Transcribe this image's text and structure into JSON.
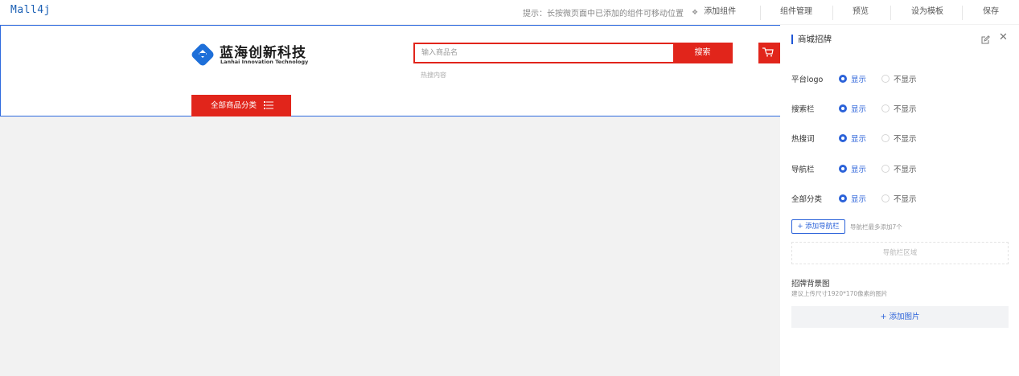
{
  "app": {
    "brand": "Mall4j"
  },
  "topbar": {
    "hint": "提示：长按微页面中已添加的组件可移动位置",
    "add_component": "添加组件",
    "component_manage": "组件管理",
    "preview": "预览",
    "set_template": "设为模板",
    "save": "保存"
  },
  "header": {
    "logo_cn": "蓝海创新科技",
    "logo_en": "Lanhai Innovation Technology",
    "search_placeholder": "输入商品名",
    "search_button": "搜索",
    "hot_words": "热搜内容",
    "all_categories": "全部商品分类",
    "accent_color": "#e1251b"
  },
  "panel": {
    "title": "商城招牌",
    "rows": [
      {
        "label": "平台logo",
        "on": "显示",
        "off": "不显示",
        "selected": "显示"
      },
      {
        "label": "搜索栏",
        "on": "显示",
        "off": "不显示",
        "selected": "显示"
      },
      {
        "label": "热搜词",
        "on": "显示",
        "off": "不显示",
        "selected": "显示"
      },
      {
        "label": "导航栏",
        "on": "显示",
        "off": "不显示",
        "selected": "显示"
      },
      {
        "label": "全部分类",
        "on": "显示",
        "off": "不显示",
        "selected": "显示"
      }
    ],
    "add_nav": "+ 添加导航栏",
    "nav_tip": "导航栏最多添加7个",
    "nav_area": "导航栏区域",
    "bg_title": "招牌背景图",
    "bg_tip": "建议上传尺寸1920*170像素的图片",
    "add_image": "+ 添加图片",
    "accent_color": "#2b62d9"
  }
}
